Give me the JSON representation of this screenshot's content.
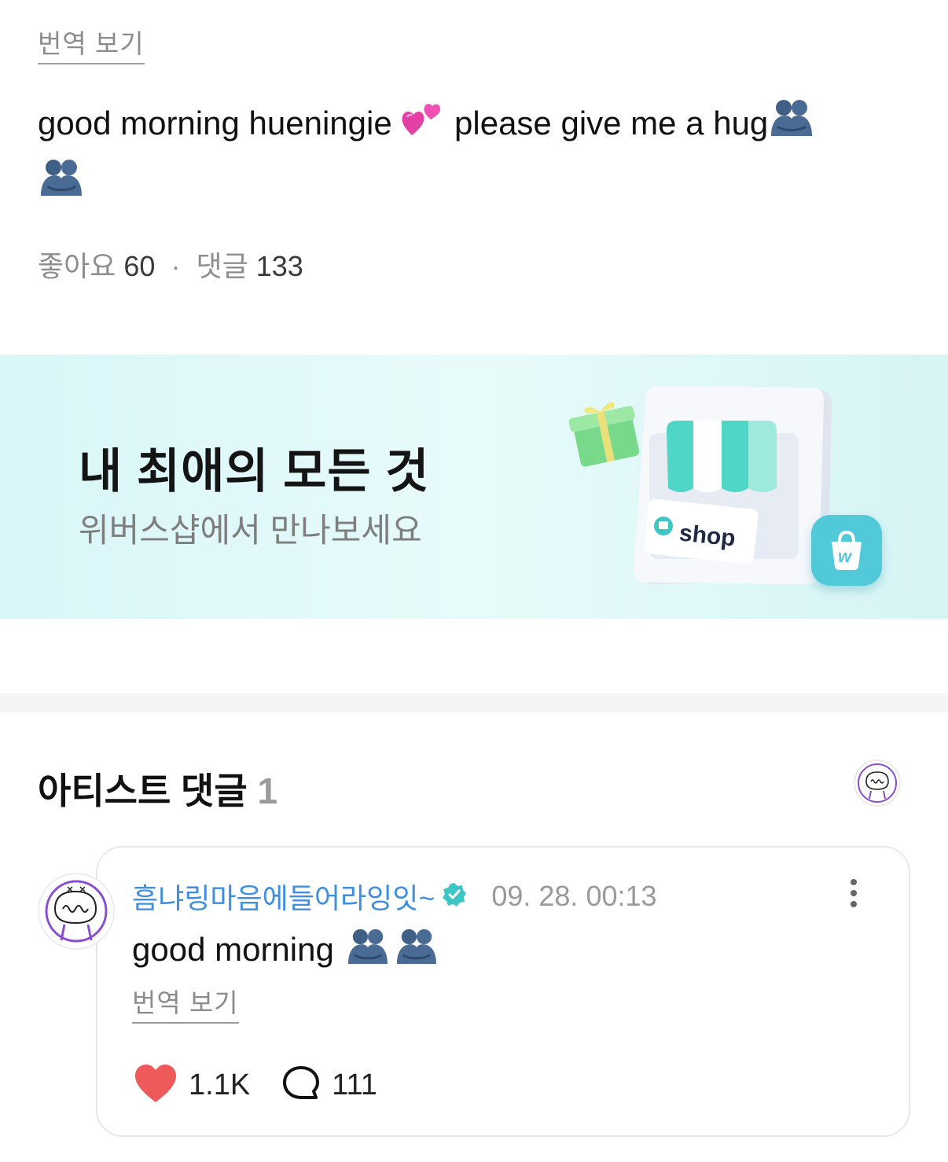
{
  "post": {
    "translate_label": "번역 보기",
    "text_part1": "good morning hueningie ",
    "text_part2": " please give me a hug",
    "likes_label": "좋아요",
    "likes_count": "60",
    "separator": "·",
    "comments_label": "댓글",
    "comments_count": "133"
  },
  "banner": {
    "title": "내 최애의 모든 것",
    "subtitle": "위버스샵에서 만나보세요",
    "shop_label": "shop",
    "badge_letter": "w"
  },
  "artist_comments": {
    "title": "아티스트 댓글",
    "count": "1"
  },
  "comment": {
    "author": "흠냐링마음에들어라잉잇~",
    "timestamp": "09. 28. 00:13",
    "text": "good morning",
    "translate_label": "번역 보기",
    "like_count": "1.1K",
    "reply_count": "111"
  },
  "icons": {
    "hearts": "two-hearts-icon",
    "hug": "people-hugging-icon",
    "verified": "verified-badge-icon",
    "more": "more-vertical-icon",
    "like": "heart-icon",
    "reply": "speech-bubble-icon"
  },
  "colors": {
    "author_blue": "#3f8fe0",
    "verified_teal": "#3ec6c6",
    "heart_red": "#ee5a5a",
    "banner_bg": "#def7f8"
  }
}
